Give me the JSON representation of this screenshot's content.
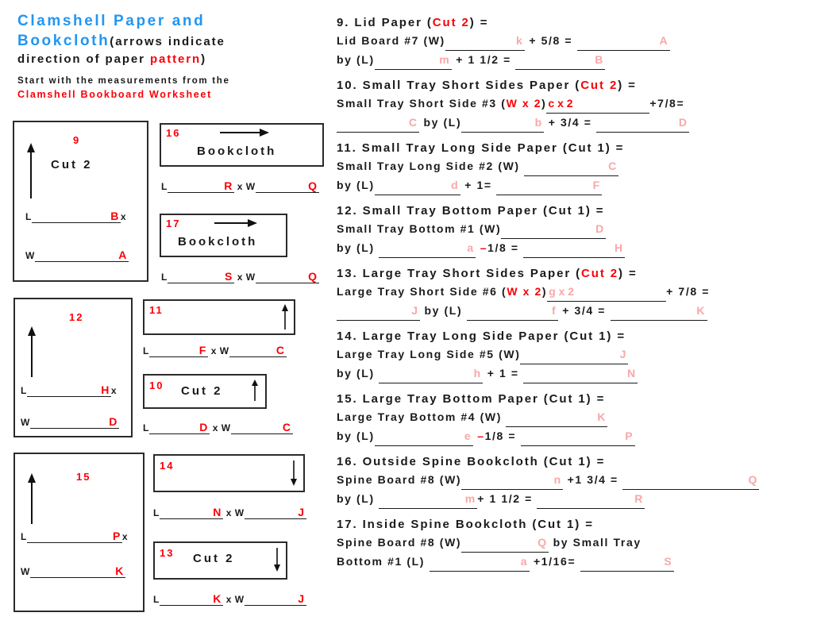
{
  "header": {
    "title_part1": "Clamshell Paper and",
    "title_part2": "Bookcloth",
    "title_note_open": "(arrows indicate",
    "title_note_line2a": "direction of paper ",
    "title_note_pattern": "pattern",
    "title_note_close": ")",
    "start_line": "Start with the measurements from the",
    "worksheet_name": "Clamshell Bookboard Worksheet"
  },
  "diagrams": [
    {
      "id": "9",
      "number": "9",
      "inner_label": "Cut 2",
      "arrow": "arrow-up",
      "length_label": "L",
      "length_value": "B",
      "times": "x",
      "width_label": "W",
      "width_value": "A"
    },
    {
      "id": "12",
      "number": "12",
      "inner_label": "",
      "arrow": "arrow-up",
      "length_label": "L",
      "length_value": "H",
      "times": "x",
      "width_label": "W",
      "width_value": "D"
    },
    {
      "id": "15",
      "number": "15",
      "inner_label": "",
      "arrow": "arrow-up",
      "length_label": "L",
      "length_value": "P",
      "times": "x",
      "width_label": "W",
      "width_value": "K"
    },
    {
      "id": "16",
      "number": "16",
      "inner_label": "Bookcloth",
      "arrow": "arrow-right",
      "length_label": "L",
      "length_value": "R",
      "times": "x",
      "width_label": "W",
      "width_value": "Q"
    },
    {
      "id": "17",
      "number": "17",
      "inner_label": "Bookcloth",
      "arrow": "arrow-right",
      "length_label": "L",
      "length_value": "S",
      "times": "x",
      "width_label": "W",
      "width_value": "Q"
    },
    {
      "id": "11",
      "number": "11",
      "inner_label": "",
      "arrow": "arrow-up",
      "length_label": "L",
      "length_value": "F",
      "times": "x",
      "width_label": "W",
      "width_value": "C"
    },
    {
      "id": "10",
      "number": "10",
      "inner_label": "Cut 2",
      "arrow": "arrow-up",
      "length_label": "L",
      "length_value": "D",
      "times": "x",
      "width_label": "W",
      "width_value": "C"
    },
    {
      "id": "14",
      "number": "14",
      "inner_label": "",
      "arrow": "arrow-down",
      "length_label": "L",
      "length_value": "N",
      "times": "x",
      "width_label": "W",
      "width_value": "J"
    },
    {
      "id": "13",
      "number": "13",
      "inner_label": "Cut 2",
      "arrow": "arrow-down",
      "length_label": "L",
      "length_value": "K",
      "times": "x",
      "width_label": "W",
      "width_value": "J"
    }
  ],
  "items": {
    "i9": {
      "title_num": "9. Lid Paper (",
      "title_cut": "Cut 2",
      "title_end": ") =",
      "l1_a": "Lid Board #7 (W)",
      "l1_blank1": "k",
      "l1_b": "+ 5/8 =",
      "l1_blank2": "A",
      "l2_a": "by (L)",
      "l2_blank1": "m",
      "l2_b": "+ 1 1/2 =",
      "l2_blank2": "B"
    },
    "i10": {
      "title_num": "10. Small Tray Short Sides Paper (",
      "title_cut": "Cut 2",
      "title_end": ") =",
      "l1_a": "Small Tray Short Side #3 (",
      "l1_wx2": "W x 2",
      "l1_a2": ")",
      "l1_blank1": "c x 2",
      "l1_b": "+7/8=",
      "l2_blank0": "C",
      "l2_a": "by (L)",
      "l2_blank1": "b",
      "l2_b": "+ 3/4 =",
      "l2_blank2": "D"
    },
    "i11": {
      "title_num": "11. Small Tray Long Side Paper (Cut 1) =",
      "l1_a": "Small Tray Long Side #2 (W)",
      "l1_blank1": "C",
      "l2_a": "by (L)",
      "l2_blank1": "d",
      "l2_b": "+ 1=",
      "l2_blank2": "F"
    },
    "i12": {
      "title_num": "12. Small Tray Bottom Paper (Cut 1) =",
      "l1_a": "Small Tray Bottom #1 (W)",
      "l1_blank1": "D",
      "l2_a": "by (L)",
      "l2_blank1": "a",
      "l2_minus": "–",
      "l2_b": "1/8 =",
      "l2_blank2": "H"
    },
    "i13": {
      "title_num": "13. Large Tray Short Sides Paper (",
      "title_cut": "Cut 2",
      "title_end": ") =",
      "l1_a": "Large Tray Short Side #6 (",
      "l1_wx2": "W x 2",
      "l1_a2": ")",
      "l1_blank1": "g x 2",
      "l1_b": "+ 7/8 =",
      "l2_blank0": "J",
      "l2_a": "by (L)",
      "l2_blank1": "f",
      "l2_b": "+ 3/4 =",
      "l2_blank2": "K"
    },
    "i14": {
      "title_num": "14. Large Tray Long Side Paper (Cut 1) =",
      "l1_a": "Large Tray Long Side #5 (W)",
      "l1_blank1": "J",
      "l2_a": "by (L)",
      "l2_blank1": "h",
      "l2_b": "+ 1 =",
      "l2_blank2": "N"
    },
    "i15": {
      "title_num": "15. Large Tray Bottom Paper (Cut 1) =",
      "l1_a": "Large Tray Bottom #4 (W)",
      "l1_blank1": "K",
      "l2_a": "by (L)",
      "l2_blank1": "e",
      "l2_minus": "–",
      "l2_b": "1/8 =",
      "l2_blank2": "P"
    },
    "i16": {
      "title_num": "16. Outside Spine Bookcloth (Cut 1) =",
      "l1_a": "Spine Board #8 (W)",
      "l1_blank1": "n",
      "l1_b": "+1 3/4 =",
      "l1_blank2": "Q",
      "l2_a": "by (L)",
      "l2_blank1": "m",
      "l2_b": "+ 1 1/2 =",
      "l2_blank2": "R"
    },
    "i17": {
      "title_num": "17. Inside Spine Bookcloth (Cut 1) =",
      "l1_a": "Spine Board #8 (W)",
      "l1_blank1": "Q",
      "l1_b": "by Small Tray",
      "l2_a": "Bottom #1 (L)",
      "l2_blank1": "a",
      "l2_b": "+1/16=",
      "l2_blank2": "S"
    }
  },
  "colors": {
    "accent_blue": "#2196f3",
    "accent_red": "#fb0007",
    "accent_pink": "#f9a7a7",
    "text": "#1a1a1a",
    "box_border": "#2b2b2b"
  }
}
